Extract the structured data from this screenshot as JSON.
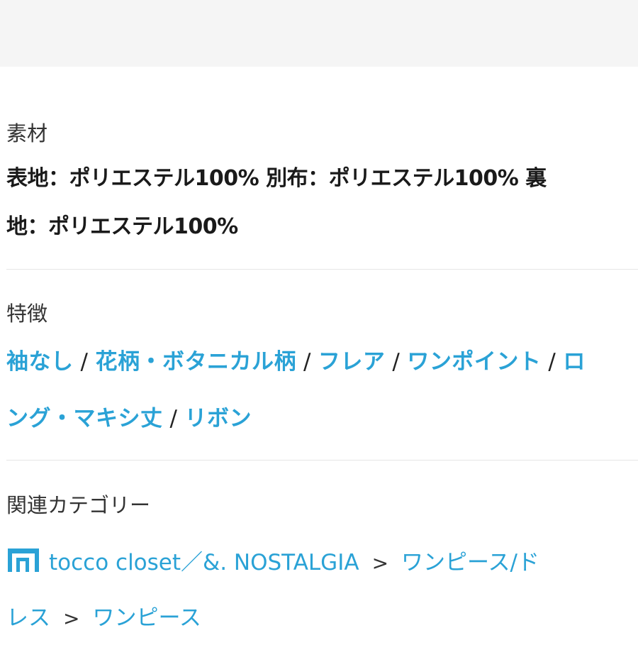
{
  "material": {
    "label": "素材",
    "line1": "表地：ポリエステル100% 別布：ポリエステル100% 裏",
    "line2": "地：ポリエステル100%"
  },
  "features": {
    "label": "特徴",
    "row1": [
      {
        "text": "袖なし"
      },
      {
        "text": "花柄・ボタニカル柄"
      },
      {
        "text": "フレア"
      },
      {
        "text": "ワンポイント"
      },
      {
        "text": "ロ"
      }
    ],
    "row2": [
      {
        "text": "ング・マキシ丈"
      },
      {
        "text": "リボン"
      }
    ],
    "separator": "/"
  },
  "related": {
    "label": "関連カテゴリー",
    "shop_icon": "shop-icon",
    "brand": "tocco closet／&. NOSTALGIA",
    "cat1_part1": "ワンピース/ド",
    "cat1_part2": "レス",
    "cat2": "ワンピース",
    "arrow": ">"
  },
  "colors": {
    "link": "#2aa2d6",
    "topbar": "#f5f5f5",
    "divider": "#e6e6e6"
  }
}
